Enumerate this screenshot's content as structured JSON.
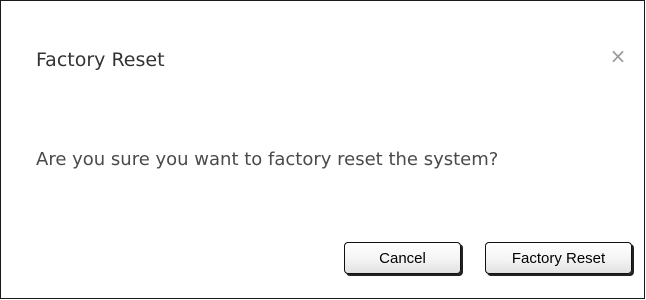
{
  "dialog": {
    "title": "Factory Reset",
    "close_glyph": "×",
    "close_icon": "close-icon",
    "message": "Are you sure you want to factory reset the system?",
    "buttons": {
      "cancel_label": "Cancel",
      "confirm_label": "Factory Reset"
    }
  },
  "colors": {
    "border": "#1a1a1a",
    "title_text": "#333333",
    "message_text": "#4a4a4a",
    "close_icon": "#9a9a9a"
  }
}
